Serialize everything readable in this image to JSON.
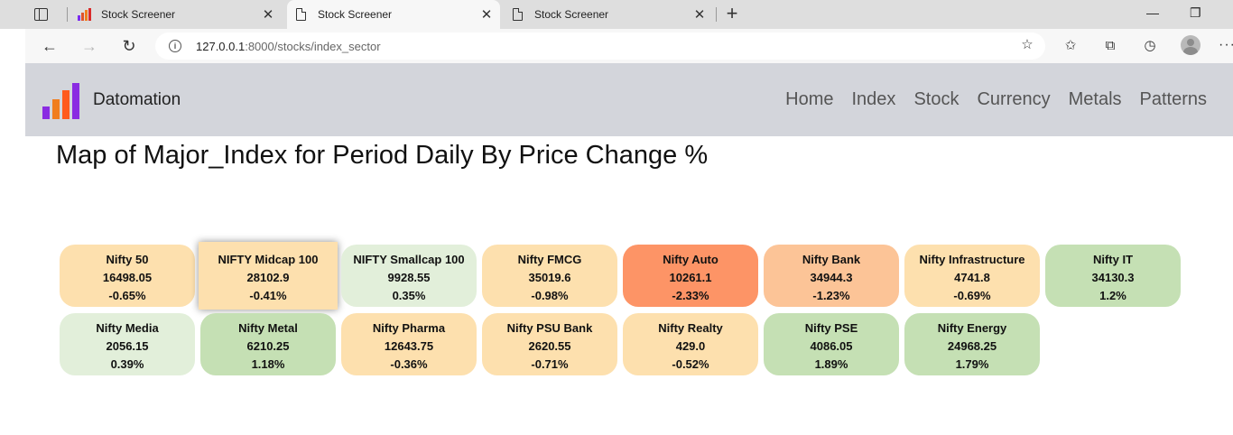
{
  "browser": {
    "tabs": [
      {
        "title": "Stock Screener",
        "active": false,
        "icon": "bar-chart-favicon"
      },
      {
        "title": "Stock Screener",
        "active": true,
        "icon": "document-icon"
      },
      {
        "title": "Stock Screener",
        "active": false,
        "icon": "document-icon"
      }
    ],
    "address": {
      "host": "127.0.0.1",
      "path": ":8000/stocks/index_sector"
    }
  },
  "site": {
    "brand": "Datomation",
    "menu": [
      "Home",
      "Index",
      "Stock",
      "Currency",
      "Metals",
      "Patterns"
    ]
  },
  "page_title": "Map of Major_Index for Period Daily By Price Change %",
  "tiles": [
    {
      "name": "Nifty 50",
      "price": "16498.05",
      "change": "-0.65%",
      "color": "#fde0ae"
    },
    {
      "name": "NIFTY Midcap 100",
      "price": "28102.9",
      "change": "-0.41%",
      "color": "#fde0ae"
    },
    {
      "name": "NIFTY Smallcap 100",
      "price": "9928.55",
      "change": "0.35%",
      "color": "#e2efda"
    },
    {
      "name": "Nifty FMCG",
      "price": "35019.6",
      "change": "-0.98%",
      "color": "#fde0ae"
    },
    {
      "name": "Nifty Auto",
      "price": "10261.1",
      "change": "-2.33%",
      "color": "#fd9466"
    },
    {
      "name": "Nifty Bank",
      "price": "34944.3",
      "change": "-1.23%",
      "color": "#fcc497"
    },
    {
      "name": "Nifty Infrastructure",
      "price": "4741.8",
      "change": "-0.69%",
      "color": "#fde0ae"
    },
    {
      "name": "Nifty IT",
      "price": "34130.3",
      "change": "1.2%",
      "color": "#c5e0b4"
    },
    {
      "name": "Nifty Media",
      "price": "2056.15",
      "change": "0.39%",
      "color": "#e2efda"
    },
    {
      "name": "Nifty Metal",
      "price": "6210.25",
      "change": "1.18%",
      "color": "#c5e0b4"
    },
    {
      "name": "Nifty Pharma",
      "price": "12643.75",
      "change": "-0.36%",
      "color": "#fde0ae"
    },
    {
      "name": "Nifty PSU Bank",
      "price": "2620.55",
      "change": "-0.71%",
      "color": "#fde0ae"
    },
    {
      "name": "Nifty Realty",
      "price": "429.0",
      "change": "-0.52%",
      "color": "#fde0ae"
    },
    {
      "name": "Nifty PSE",
      "price": "4086.05",
      "change": "1.89%",
      "color": "#c5e0b4"
    },
    {
      "name": "Nifty Energy",
      "price": "24968.25",
      "change": "1.79%",
      "color": "#c5e0b4"
    }
  ]
}
